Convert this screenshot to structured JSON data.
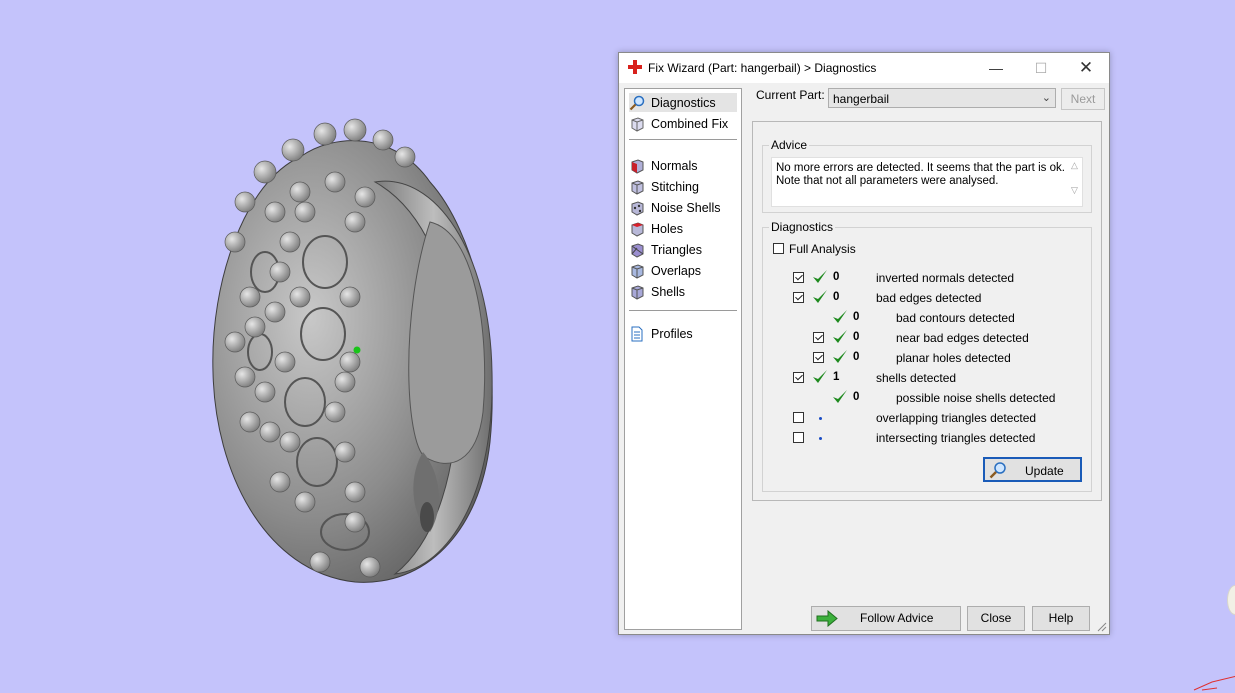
{
  "window": {
    "title": "Fix Wizard (Part: hangerbail) > Diagnostics",
    "icons": {
      "app": "red-cross-icon",
      "minimize": "minimize-icon",
      "maximize": "maximize-icon",
      "close": "close-icon"
    }
  },
  "nav": {
    "items": [
      {
        "label": "Diagnostics",
        "icon": "magnifier-icon",
        "selected": true
      },
      {
        "label": "Combined Fix",
        "icon": "cube-icon"
      },
      {
        "label": "Normals",
        "icon": "normals-cube-icon"
      },
      {
        "label": "Stitching",
        "icon": "stitching-cube-icon"
      },
      {
        "label": "Noise Shells",
        "icon": "noise-shells-icon"
      },
      {
        "label": "Holes",
        "icon": "holes-cube-icon"
      },
      {
        "label": "Triangles",
        "icon": "triangles-cube-icon"
      },
      {
        "label": "Overlaps",
        "icon": "overlaps-cube-icon"
      },
      {
        "label": "Shells",
        "icon": "shells-cube-icon"
      },
      {
        "label": "Profiles",
        "icon": "document-icon"
      }
    ]
  },
  "current_part": {
    "label": "Current Part:",
    "value": "hangerbail",
    "next_label": "Next"
  },
  "advice": {
    "title": "Advice",
    "text": "No more errors are detected. It seems that the part is ok. Note that not all parameters were analysed."
  },
  "diagnostics": {
    "title": "Diagnostics",
    "full_analysis_label": "Full Analysis",
    "full_analysis_checked": false,
    "rows": [
      {
        "checkbox": true,
        "checked": true,
        "status": "ok",
        "count": "0",
        "label": "inverted normals detected"
      },
      {
        "checkbox": true,
        "checked": true,
        "status": "ok",
        "count": "0",
        "label": "bad edges detected"
      },
      {
        "checkbox": false,
        "status": "ok",
        "count": "0",
        "label": "bad contours detected",
        "indent": 1
      },
      {
        "checkbox": true,
        "checked": true,
        "status": "ok",
        "count": "0",
        "label": "near bad edges detected",
        "indent": 1
      },
      {
        "checkbox": true,
        "checked": true,
        "status": "ok",
        "count": "0",
        "label": "planar holes detected",
        "indent": 1
      },
      {
        "checkbox": true,
        "checked": true,
        "status": "ok",
        "count": "1",
        "label": "shells detected"
      },
      {
        "checkbox": false,
        "status": "ok",
        "count": "0",
        "label": "possible noise shells detected",
        "indent": 1
      },
      {
        "checkbox": true,
        "checked": false,
        "status": "not-run",
        "count": "",
        "label": "overlapping triangles detected"
      },
      {
        "checkbox": true,
        "checked": false,
        "status": "not-run",
        "count": "",
        "label": "intersecting triangles detected"
      }
    ],
    "update_label": "Update"
  },
  "footer": {
    "follow_advice": "Follow Advice",
    "close": "Close",
    "help": "Help"
  },
  "colors": {
    "background": "#c4c3fb",
    "ok_tick": "#1e8a1e",
    "accent_border": "#1a5bb8"
  }
}
